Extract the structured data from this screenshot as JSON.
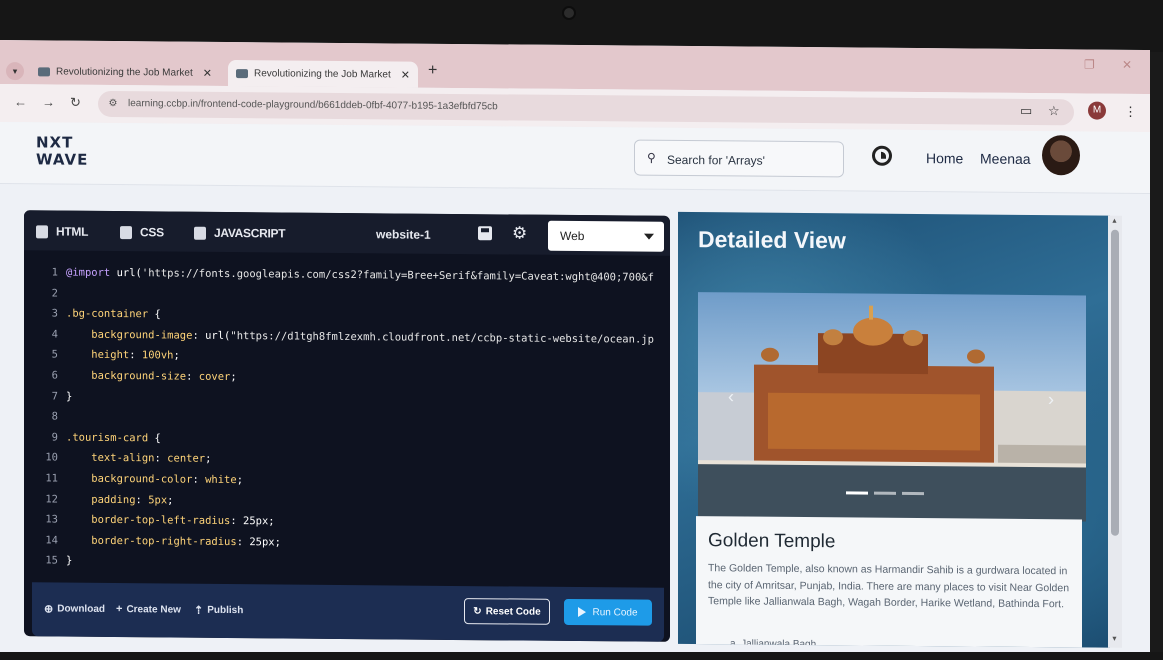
{
  "browser": {
    "tabs": [
      {
        "title": "Revolutionizing the Job Market"
      },
      {
        "title": "Revolutionizing the Job Market"
      }
    ],
    "url": "learning.ccbp.in/frontend-code-playground/b661ddeb-0fbf-4077-b195-1a3efbfd75cb",
    "profile_initial": "M"
  },
  "header": {
    "logo_line1": "NXT",
    "logo_line2": "WAVE",
    "search_placeholder": "Search for 'Arrays'",
    "nav_home": "Home",
    "nav_user": "Meenaa"
  },
  "editor": {
    "tabs": [
      {
        "label": "HTML"
      },
      {
        "label": "CSS"
      },
      {
        "label": "JAVASCRIPT"
      }
    ],
    "file_name": "website-1",
    "mode": "Web",
    "lines": [
      {
        "n": "1",
        "parts": [
          [
            "k-at",
            "@import"
          ],
          [
            "k-val",
            " url("
          ],
          [
            "k-str",
            "'https://fonts.googleapis.com/css2?family=Bree+Serif&family=Caveat:wght@400;700&f"
          ]
        ]
      },
      {
        "n": "2",
        "parts": []
      },
      {
        "n": "3",
        "parts": [
          [
            "k-sel",
            ".bg-container"
          ],
          [
            "k-val",
            " {"
          ]
        ]
      },
      {
        "n": "4",
        "parts": [
          [
            "k-prop",
            "    background-image"
          ],
          [
            "k-val",
            ": url("
          ],
          [
            "k-str",
            "\"https://d1tgh8fmlzexmh.cloudfront.net/ccbp-static-website/ocean.jp"
          ]
        ]
      },
      {
        "n": "5",
        "parts": [
          [
            "k-prop",
            "    height"
          ],
          [
            "k-val",
            ": "
          ],
          [
            "k-prop",
            "100vh"
          ],
          [
            "k-val",
            ";"
          ]
        ]
      },
      {
        "n": "6",
        "parts": [
          [
            "k-prop",
            "    background-size"
          ],
          [
            "k-val",
            ": "
          ],
          [
            "k-prop",
            "cover"
          ],
          [
            "k-val",
            ";"
          ]
        ]
      },
      {
        "n": "7",
        "parts": [
          [
            "k-val",
            "}"
          ]
        ]
      },
      {
        "n": "8",
        "parts": []
      },
      {
        "n": "9",
        "parts": [
          [
            "k-sel",
            ".tourism-card"
          ],
          [
            "k-val",
            " {"
          ]
        ]
      },
      {
        "n": "10",
        "parts": [
          [
            "k-prop",
            "    text-align"
          ],
          [
            "k-val",
            ": "
          ],
          [
            "k-prop",
            "center"
          ],
          [
            "k-val",
            ";"
          ]
        ]
      },
      {
        "n": "11",
        "parts": [
          [
            "k-prop",
            "    background-color"
          ],
          [
            "k-val",
            ": "
          ],
          [
            "k-prop",
            "white"
          ],
          [
            "k-val",
            ";"
          ]
        ]
      },
      {
        "n": "12",
        "parts": [
          [
            "k-prop",
            "    padding"
          ],
          [
            "k-val",
            ": "
          ],
          [
            "k-prop",
            "5px"
          ],
          [
            "k-val",
            ";"
          ]
        ]
      },
      {
        "n": "13",
        "parts": [
          [
            "k-prop",
            "    border-top-left-radius"
          ],
          [
            "k-val",
            ": 25px;"
          ]
        ]
      },
      {
        "n": "14",
        "parts": [
          [
            "k-prop",
            "    border-top-right-radius"
          ],
          [
            "k-val",
            ": 25px;"
          ]
        ]
      },
      {
        "n": "15",
        "parts": [
          [
            "k-val",
            "}"
          ]
        ]
      }
    ],
    "footer": {
      "download": "Download",
      "create_new": "Create New",
      "publish": "Publish",
      "reset": "Reset Code",
      "run": "Run Code"
    }
  },
  "preview": {
    "title": "Detailed View",
    "card_title": "Golden Temple",
    "card_desc": "The Golden Temple, also known as Harmandir Sahib is a gurdwara located in the city of Amritsar, Punjab, India. There are many places to visit Near Golden Temple like Jallianwala Bagh, Wagah Border, Harike Wetland, Bathinda Fort.",
    "card_list_item": "a. Jallianwala Bagh"
  }
}
